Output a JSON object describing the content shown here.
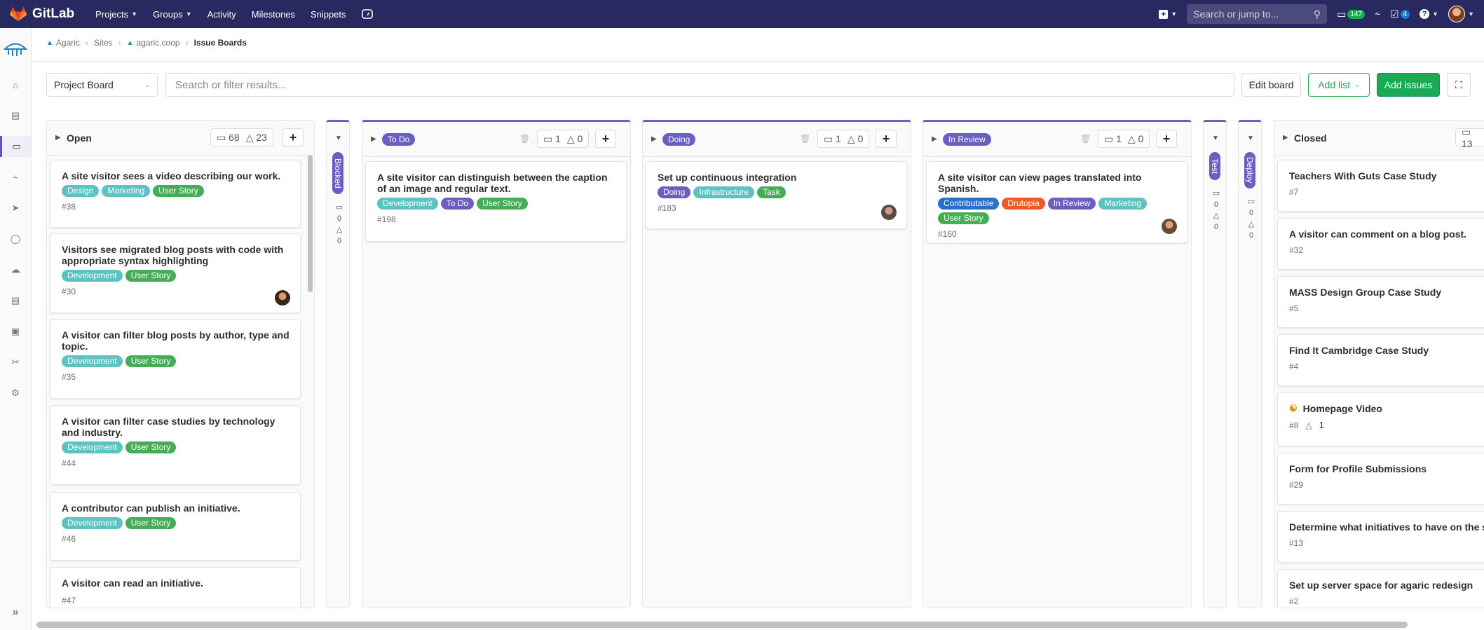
{
  "topnav": {
    "brand": "GitLab",
    "menu": [
      {
        "label": "Projects",
        "dropdown": true
      },
      {
        "label": "Groups",
        "dropdown": true
      },
      {
        "label": "Activity",
        "dropdown": false
      },
      {
        "label": "Milestones",
        "dropdown": false
      },
      {
        "label": "Snippets",
        "dropdown": false
      }
    ],
    "search_placeholder": "Search or jump to...",
    "issues_count": "147",
    "todos_count": "4"
  },
  "breadcrumb": [
    "Agaric",
    "Sites",
    "agaric.coop",
    "Issue Boards"
  ],
  "filterbar": {
    "board": "Project Board",
    "search_placeholder": "Search or filter results...",
    "edit_board": "Edit board",
    "add_list": "Add list",
    "add_issues": "Add issues"
  },
  "colors": {
    "purple": "#6a5fc1",
    "green": "#1aaa55",
    "teal": "#5dc2c2",
    "navy": "#292961"
  },
  "lists": {
    "open": {
      "title": "Open",
      "issues": "68",
      "weight": "23",
      "cards": [
        {
          "title": "A site visitor sees a video describing our work.",
          "labels": [
            "Design",
            "Marketing",
            "User Story"
          ],
          "number": "#38"
        },
        {
          "title": "Visitors see migrated blog posts with code with appropriate syntax highlighting",
          "labels": [
            "Development",
            "User Story"
          ],
          "number": "#30"
        },
        {
          "title": "A visitor can filter blog posts by author, type and topic.",
          "labels": [
            "Development",
            "User Story"
          ],
          "number": "#35"
        },
        {
          "title": "A visitor can filter case studies by technology and industry.",
          "labels": [
            "Development",
            "User Story"
          ],
          "number": "#44"
        },
        {
          "title": "A contributor can publish an initiative.",
          "labels": [
            "Development",
            "User Story"
          ],
          "number": "#46"
        },
        {
          "title": "A visitor can read an initiative.",
          "labels": [],
          "number": "#47"
        }
      ]
    },
    "blocked": {
      "title": "Blocked",
      "issues": "0",
      "weight": "0"
    },
    "todo": {
      "title": "To Do",
      "issues": "1",
      "weight": "0",
      "cards": [
        {
          "title": "A site visitor can distinguish between the caption of an image and regular text.",
          "labels": [
            "Development",
            "To Do",
            "User Story"
          ],
          "number": "#198"
        }
      ]
    },
    "doing": {
      "title": "Doing",
      "issues": "1",
      "weight": "0",
      "cards": [
        {
          "title": "Set up continuous integration",
          "labels": [
            "Doing",
            "Infrastructure",
            "Task"
          ],
          "number": "#183"
        }
      ]
    },
    "review": {
      "title": "In Review",
      "issues": "1",
      "weight": "0",
      "cards": [
        {
          "title": "A site visitor can view pages translated into Spanish.",
          "labels": [
            "Contributable",
            "Drutopia",
            "In Review",
            "Marketing",
            "User Story"
          ],
          "number": "#160"
        }
      ]
    },
    "test": {
      "title": "Test",
      "issues": "0",
      "weight": "0"
    },
    "deploy": {
      "title": "Deploy",
      "issues": "0",
      "weight": "0"
    },
    "closed": {
      "title": "Closed",
      "issues": "13",
      "cards": [
        {
          "title": "Teachers With Guts Case Study",
          "number": "#7"
        },
        {
          "title": "A visitor can comment on a blog post.",
          "number": "#32"
        },
        {
          "title": "MASS Design Group Case Study",
          "number": "#5"
        },
        {
          "title": "Find It Cambridge Case Study",
          "number": "#4"
        },
        {
          "title": "Homepage Video",
          "number": "#8",
          "weight": "1"
        },
        {
          "title": "Form for Profile Submissions",
          "number": "#29"
        },
        {
          "title": "Determine what initiatives to have on the site",
          "number": "#13"
        },
        {
          "title": "Set up server space for agaric redesign",
          "number": "#2"
        }
      ]
    }
  }
}
